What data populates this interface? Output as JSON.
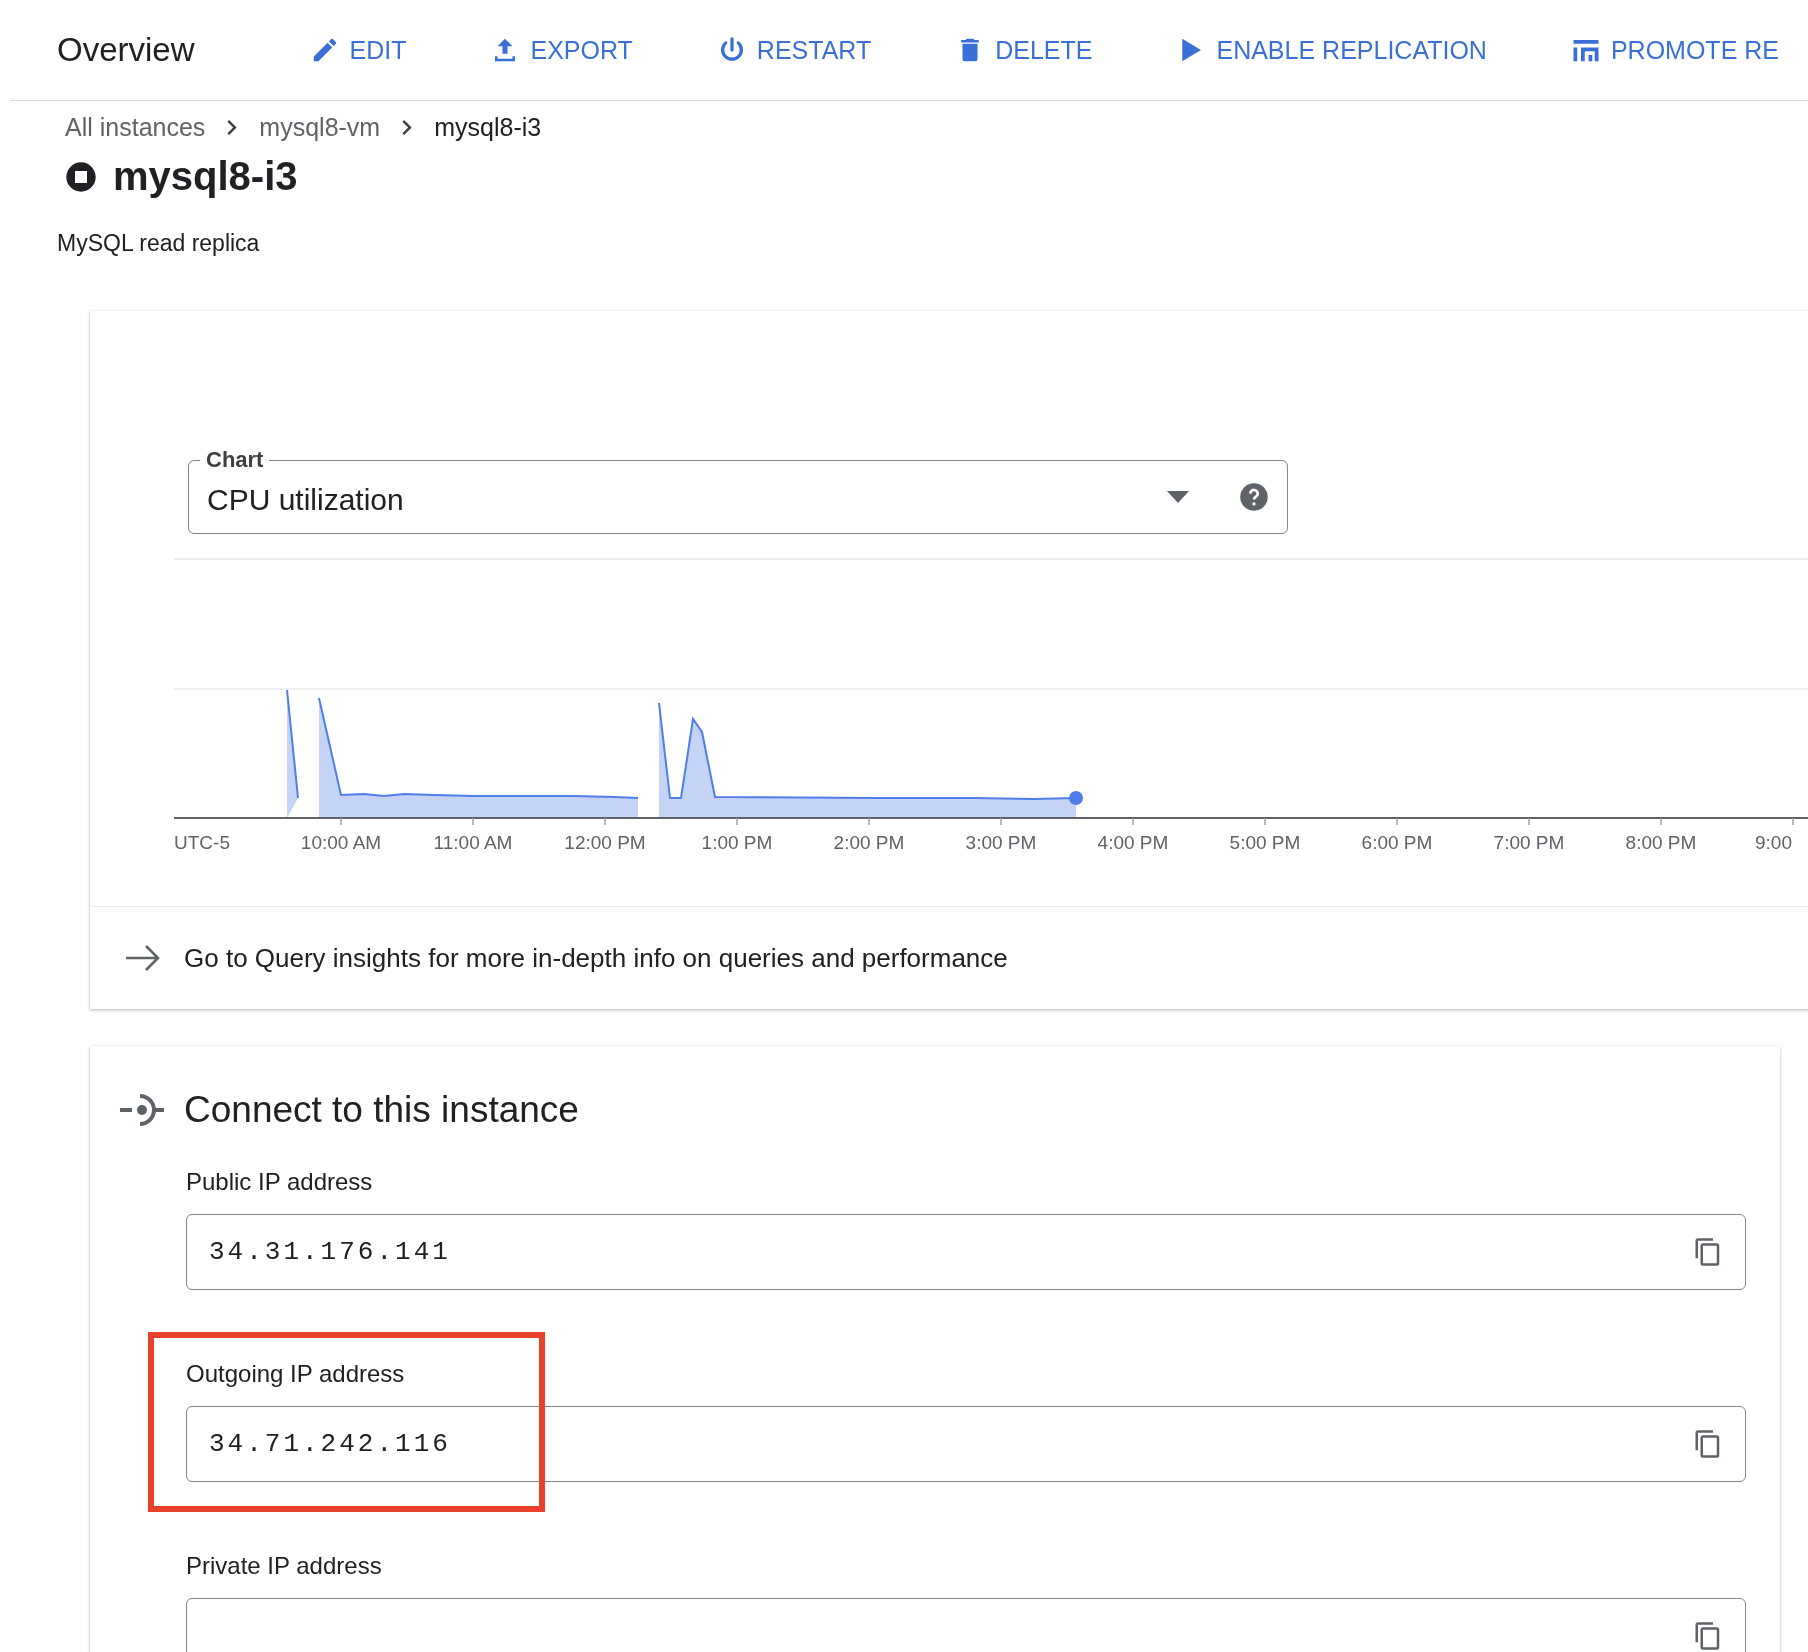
{
  "header": {
    "title": "Overview",
    "actions": [
      {
        "kind": "edit",
        "label": "EDIT"
      },
      {
        "kind": "export",
        "label": "EXPORT"
      },
      {
        "kind": "restart",
        "label": "RESTART"
      },
      {
        "kind": "delete",
        "label": "DELETE"
      },
      {
        "kind": "replicate",
        "label": "ENABLE REPLICATION"
      },
      {
        "kind": "promote",
        "label": "PROMOTE RE"
      }
    ]
  },
  "breadcrumbs": [
    {
      "label": "All instances",
      "current": false
    },
    {
      "label": "mysql8-vm",
      "current": false
    },
    {
      "label": "mysql8-i3",
      "current": true
    }
  ],
  "instance": {
    "name": "mysql8-i3",
    "type": "MySQL read replica"
  },
  "chart_card": {
    "select": {
      "label": "Chart",
      "value": "CPU utilization"
    },
    "time_axis": [
      "UTC-5",
      "10:00 AM",
      "11:00 AM",
      "12:00 PM",
      "1:00 PM",
      "2:00 PM",
      "3:00 PM",
      "4:00 PM",
      "5:00 PM",
      "6:00 PM",
      "7:00 PM",
      "8:00 PM",
      "9:00"
    ],
    "link": "Go to Query insights for more in-depth info on queries and performance"
  },
  "connect": {
    "title": "Connect to this instance",
    "fields": [
      {
        "label": "Public IP address",
        "value": "34.31.176.141",
        "highlighted": false
      },
      {
        "label": "Outgoing IP address",
        "value": "34.71.242.116",
        "highlighted": true
      },
      {
        "label": "Private IP address",
        "highlighted": false
      }
    ]
  }
}
